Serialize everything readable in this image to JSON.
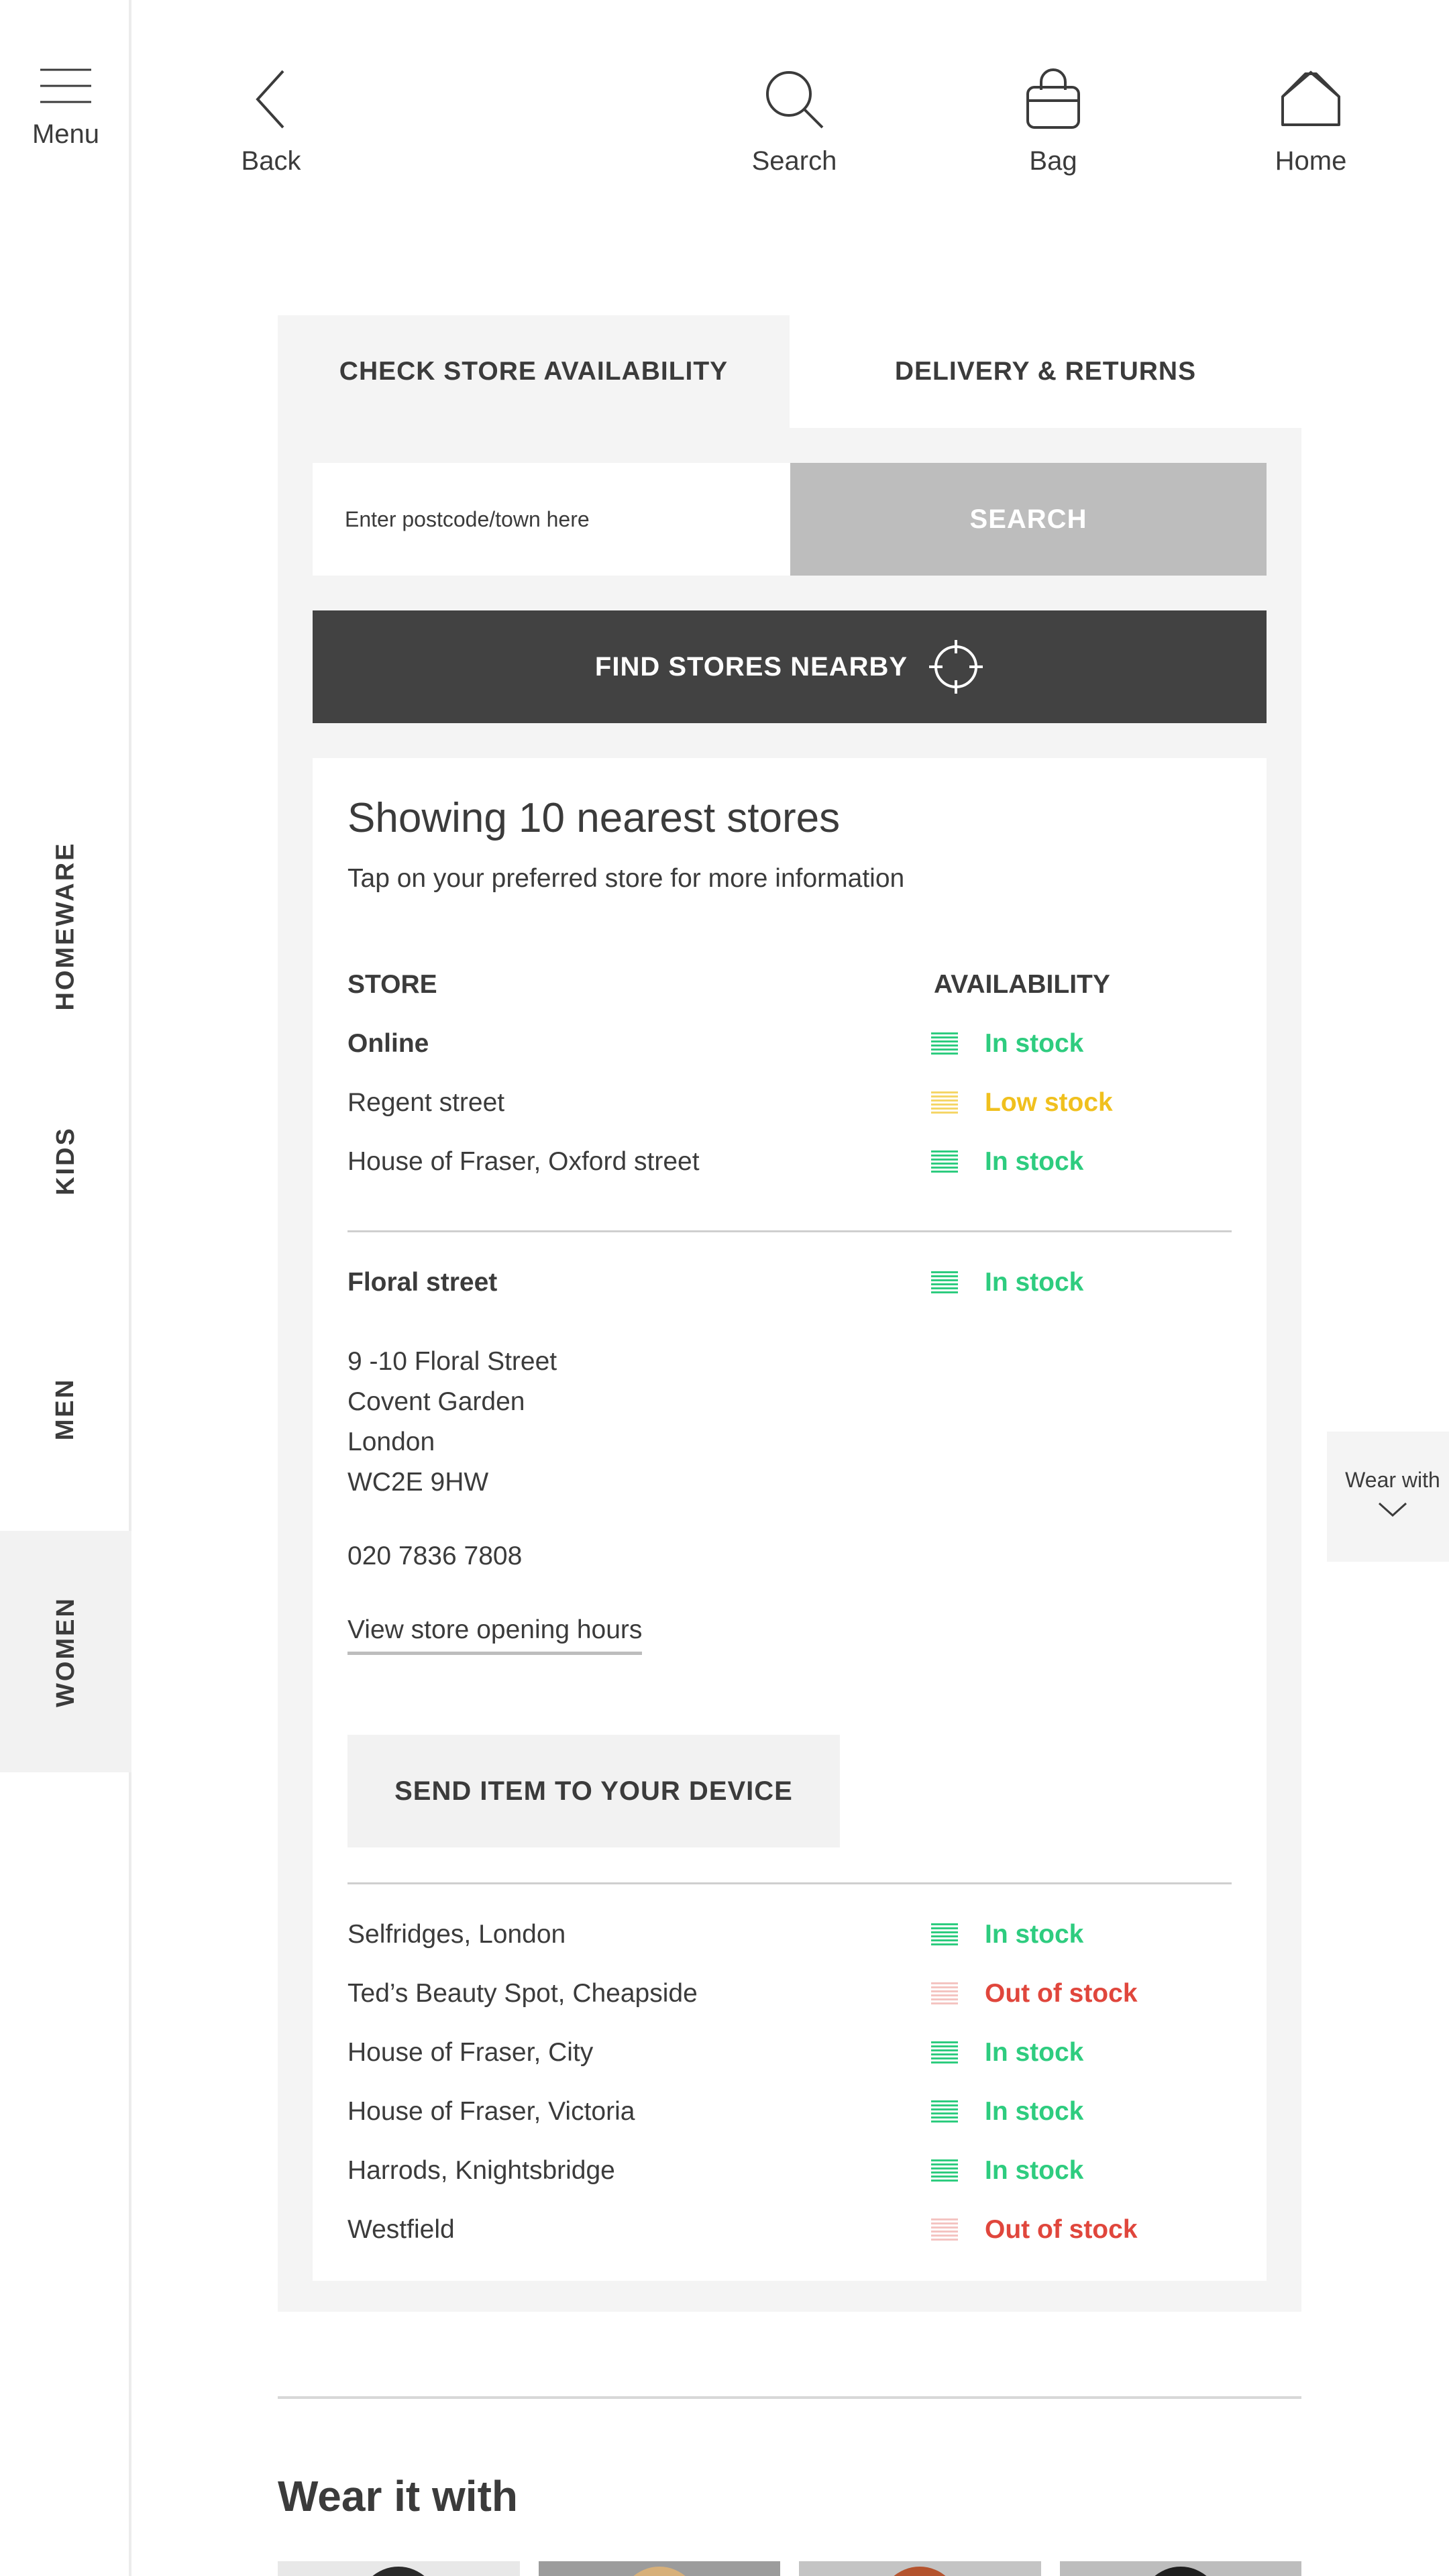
{
  "rail": {
    "menu_label": "Menu",
    "categories": [
      "HOMEWARE",
      "KIDS",
      "MEN",
      "WOMEN"
    ],
    "active_category": "WOMEN"
  },
  "nav": {
    "back": "Back",
    "search": "Search",
    "bag": "Bag",
    "home": "Home"
  },
  "tabs": {
    "active": "CHECK STORE AVAILABILITY",
    "inactive": "DELIVERY & RETURNS"
  },
  "search": {
    "placeholder": "Enter postcode/town here",
    "value": "",
    "button": "SEARCH"
  },
  "nearby_button": "FIND STORES NEARBY",
  "results": {
    "title": "Showing 10 nearest stores",
    "subtitle": "Tap on your preferred store for more information",
    "col_store": "STORE",
    "col_availability": "AVAILABILITY",
    "top_rows": [
      {
        "store": "Online",
        "status": "In stock",
        "level": "in"
      },
      {
        "store": "Regent street",
        "status": "Low stock",
        "level": "low"
      },
      {
        "store": "House of Fraser, Oxford street",
        "status": "In stock",
        "level": "in"
      }
    ],
    "selected": {
      "store": "Floral street",
      "status": "In stock",
      "level": "in",
      "address": [
        "9 -10 Floral Street",
        "Covent Garden",
        "London",
        "WC2E 9HW"
      ],
      "phone": "020 7836 7808",
      "hours_link": "View store opening hours",
      "send_button": "SEND ITEM TO YOUR DEVICE"
    },
    "bottom_rows": [
      {
        "store": "Selfridges, London",
        "status": "In stock",
        "level": "in"
      },
      {
        "store": "Ted’s Beauty Spot, Cheapside",
        "status": "Out of stock",
        "level": "out"
      },
      {
        "store": "House of Fraser, City",
        "status": "In stock",
        "level": "in"
      },
      {
        "store": "House of Fraser, Victoria",
        "status": "In stock",
        "level": "in"
      },
      {
        "store": "Harrods, Knightsbridge",
        "status": "In stock",
        "level": "in"
      },
      {
        "store": "Westfield",
        "status": "Out of stock",
        "level": "out"
      }
    ]
  },
  "wear_with_tab": "Wear with",
  "wear_it_with_heading": "Wear it with",
  "colors": {
    "in_stock": "#2ecc7f",
    "low_stock": "#f0c01e",
    "out_of_stock": "#e0463c",
    "out_icon": "#f4c4c1",
    "low_icon": "#f5d668",
    "dark_button": "#424242",
    "search_button": "#bdbdbd"
  },
  "icons": {
    "menu": "hamburger-icon",
    "back": "chevron-left-icon",
    "search": "magnifier-icon",
    "bag": "shopping-bag-icon",
    "home": "house-icon",
    "nearby": "crosshair-icon",
    "stock": "stock-bars-icon",
    "wear_with": "chevron-down-icon"
  }
}
